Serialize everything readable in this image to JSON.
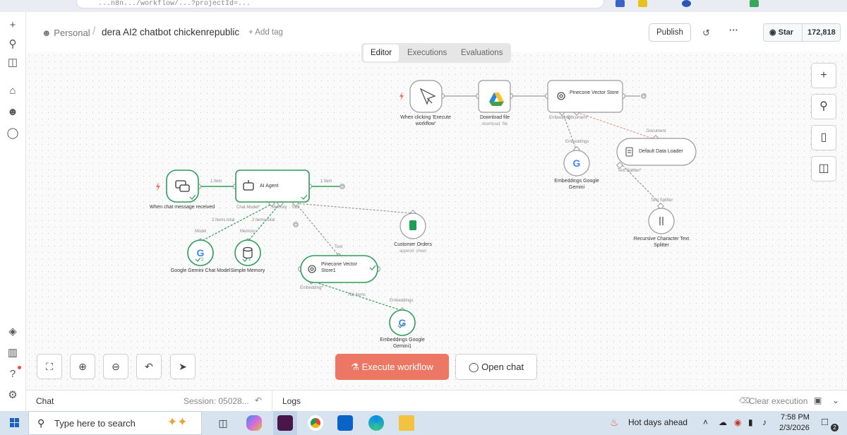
{
  "browser": {
    "url": "...n8n.../workflow/...?projectId=..."
  },
  "header": {
    "breadcrumb_project": "Personal",
    "separator": "/",
    "workflow_title": "dera AI2 chatbot chickenrepublic",
    "add_tag": "+ Add tag",
    "publish_label": "Publish",
    "github_star_label": "Star",
    "github_star_count": "172,818"
  },
  "tabs": {
    "editor": "Editor",
    "executions": "Executions",
    "evaluations": "Evaluations"
  },
  "nodes": {
    "trigger_manual": "When clicking 'Execute workflow'",
    "download_file": "Download file",
    "download_file_sub": "download: file",
    "pinecone_top": "Pinecone Vector Store",
    "embeddings_top": "Embeddings Google Gemini",
    "default_loader": "Default Data Loader",
    "text_splitter": "Recursive Character Text Splitter",
    "chat_trigger": "When chat message received",
    "ai_agent": "AI Agent",
    "gemini_chat": "Google Gemini Chat Model",
    "simple_memory": "Simple Memory",
    "customer_orders": "Customer Orders",
    "customer_orders_sub": "append: sheet",
    "pinecone_bottom": "Pinecone Vector Store1",
    "embeddings_bottom": "Embeddings Google Gemini1"
  },
  "edge_labels": {
    "one_item_a": "1 item",
    "one_item_b": "1 item",
    "chat_model": "Chat Model*",
    "memory": "Memory",
    "tool": "Tool",
    "two_items_a": "2 items total",
    "two_items_b": "2 items total",
    "model": "Model",
    "memory_in": "Memory",
    "tool_in": "Tool",
    "embedding_out": "Embedding*",
    "embed_items": "768 items",
    "embeddings_in": "Embeddings",
    "embed_top_out": "Embedding*",
    "document_out": "Document*",
    "document_in": "Document",
    "embeddings_top_in": "Embeddings",
    "text_splitter_out": "Text Splitter*",
    "text_splitter_in": "Text Splitter",
    "gemini_badge": "2",
    "memory_badge": "2"
  },
  "actions": {
    "execute_workflow": "Execute workflow",
    "open_chat": "Open chat"
  },
  "bottom_panel": {
    "chat_label": "Chat",
    "session": "Session: 05028...",
    "logs_label": "Logs",
    "clear_execution": "Clear execution"
  },
  "taskbar": {
    "search_placeholder": "Type here to search",
    "weather": "Hot days ahead",
    "time": "7:58 PM",
    "date": "2/3/2026",
    "notifications": "2"
  },
  "colors": {
    "execute_button": "#ec7764",
    "success_green": "#2e9c5a",
    "trigger_bolt": "#ff6d5a",
    "canvas_bg": "#fafafa",
    "taskbar_bg": "#d8e3f0"
  }
}
